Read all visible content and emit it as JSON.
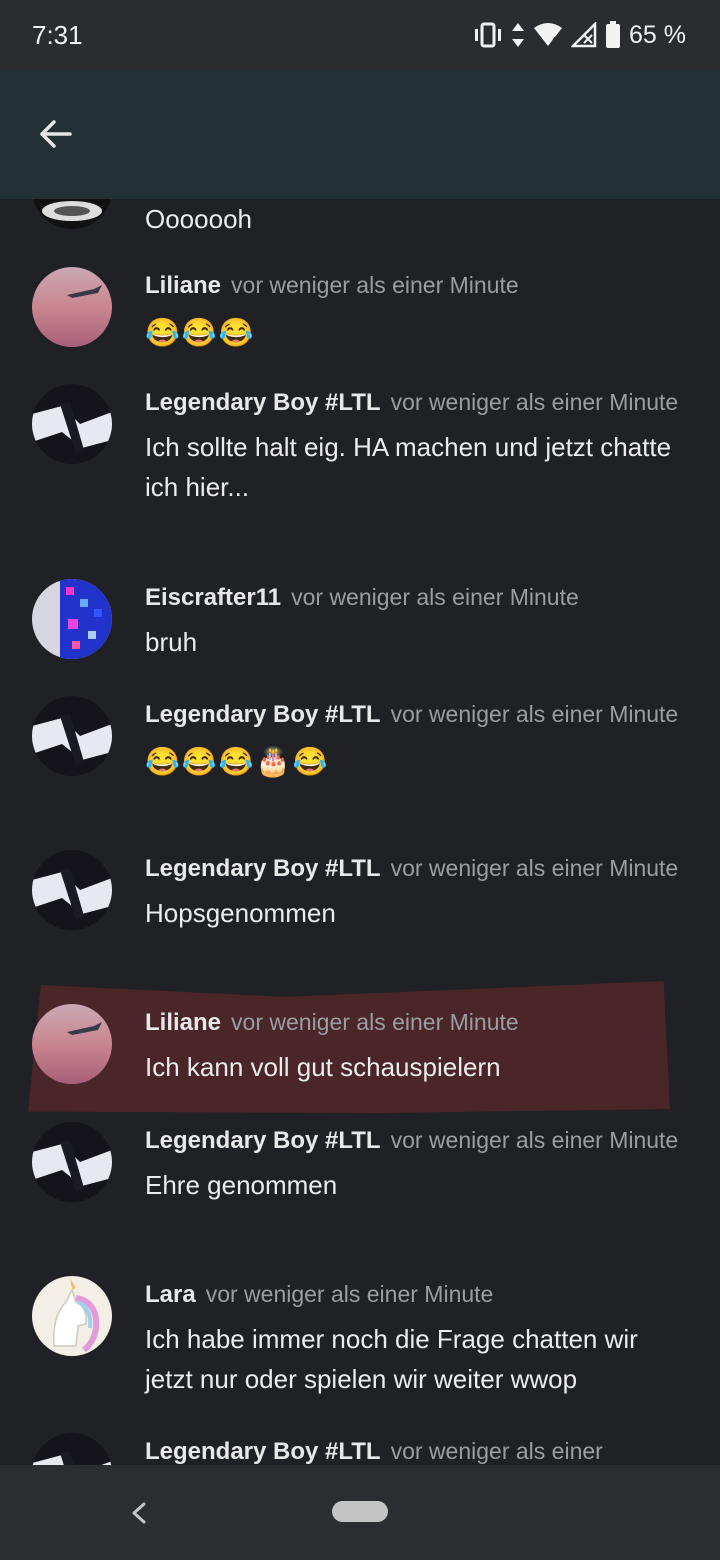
{
  "status_bar": {
    "time": "7:31",
    "battery": "65 %",
    "icons": [
      "vibrate-icon",
      "data-arrows-icon",
      "wifi-icon",
      "signal-icon",
      "battery-icon"
    ]
  },
  "app_bar": {
    "back_icon": "arrow-left-icon"
  },
  "messages": [
    {
      "author": "",
      "time": "",
      "text": "Ooooooh"
    },
    {
      "author": "Liliane",
      "time": "vor weniger als einer Minute",
      "text": "😂😂😂"
    },
    {
      "author": "Legendary Boy #LTL",
      "time": "vor weniger als einer Minute",
      "text": "Ich sollte halt eig. HA machen und jetzt chatte ich hier..."
    },
    {
      "author": "Eiscrafter11",
      "time": "vor weniger als einer Minute",
      "text": "bruh"
    },
    {
      "author": "Legendary Boy #LTL",
      "time": "vor weniger als einer Minute",
      "text": "😂😂😂🎂😂"
    },
    {
      "author": "Legendary Boy #LTL",
      "time": "vor weniger als einer Minute",
      "text": "Hopsgenommen"
    },
    {
      "author": "Liliane",
      "time": "vor weniger als einer Minute",
      "text": "Ich kann voll gut schauspielern"
    },
    {
      "author": "Legendary Boy #LTL",
      "time": "vor weniger als einer Minute",
      "text": "Ehre genommen"
    },
    {
      "author": "Lara",
      "time": "vor weniger als einer Minute",
      "text": "Ich habe immer noch die Frage chatten wir jetzt nur oder spielen wir weiter wwop"
    },
    {
      "author": "Legendary Boy #LTL",
      "time": "vor weniger als einer",
      "text": ""
    }
  ],
  "nav_bar": {
    "back_icon": "nav-back-icon",
    "home_icon": "home-pill"
  },
  "colors": {
    "app_bar": "#233034",
    "background": "#1f2124",
    "highlight": "#4a2628"
  }
}
